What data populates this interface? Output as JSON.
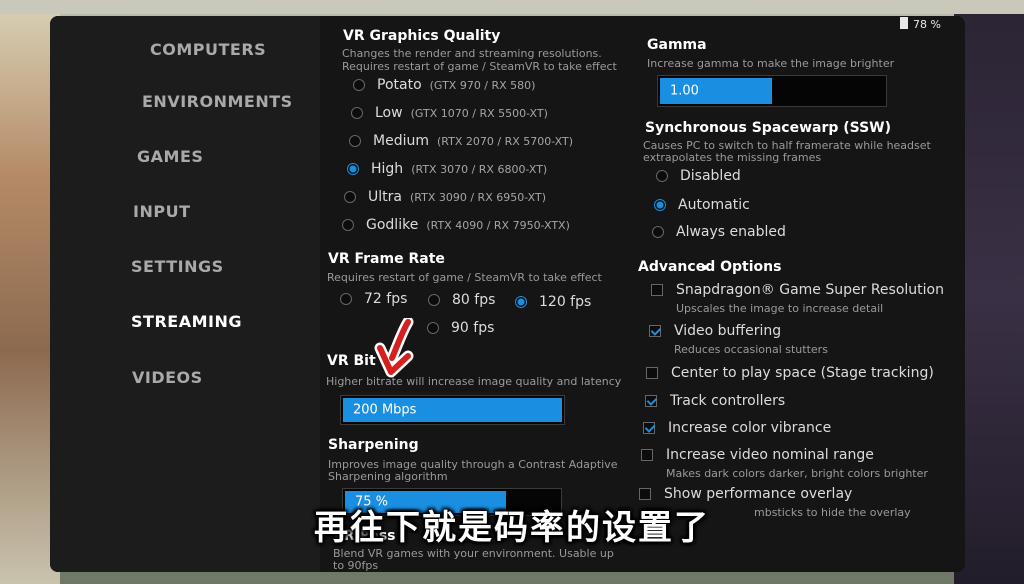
{
  "status": {
    "battery": "78 %"
  },
  "sidebar": {
    "items": [
      {
        "label": "COMPUTERS"
      },
      {
        "label": "ENVIRONMENTS"
      },
      {
        "label": "GAMES"
      },
      {
        "label": "INPUT"
      },
      {
        "label": "SETTINGS"
      },
      {
        "label": "STREAMING",
        "active": true
      },
      {
        "label": "VIDEOS"
      }
    ]
  },
  "graphics_quality": {
    "title": "VR Graphics Quality",
    "desc1": "Changes the render and streaming resolutions.",
    "desc2": "Requires restart of game / SteamVR to take effect",
    "options": [
      {
        "label": "Potato",
        "spec": "(GTX 970 / RX 580)",
        "selected": false
      },
      {
        "label": "Low",
        "spec": "(GTX 1070 / RX 5500-XT)",
        "selected": false
      },
      {
        "label": "Medium",
        "spec": "(RTX 2070 / RX 5700-XT)",
        "selected": false
      },
      {
        "label": "High",
        "spec": "(RTX 3070 / RX 6800-XT)",
        "selected": true
      },
      {
        "label": "Ultra",
        "spec": "(RTX 3090 / RX 6950-XT)",
        "selected": false
      },
      {
        "label": "Godlike",
        "spec": "(RTX 4090 / RX 7950-XTX)",
        "selected": false
      }
    ]
  },
  "frame_rate": {
    "title": "VR Frame Rate",
    "desc": "Requires restart of game / SteamVR to take effect",
    "options": [
      {
        "label": "72 fps",
        "selected": false
      },
      {
        "label": "80 fps",
        "selected": false
      },
      {
        "label": "120 fps",
        "selected": true
      },
      {
        "label": "90 fps",
        "selected": false
      }
    ]
  },
  "bitrate": {
    "title": "VR Bit",
    "desc": "Higher bitrate will increase image quality and latency",
    "value": "200 Mbps",
    "fill_fraction": 1.0
  },
  "sharpening": {
    "title": "Sharpening",
    "desc1": "Improves image quality through a Contrast Adaptive",
    "desc2": "Sharpening algorithm",
    "value": "75 %",
    "fill_fraction": 0.75
  },
  "passthrough": {
    "title": "VR Pass",
    "desc1": "Blend VR games with your environment. Usable up",
    "desc2": "to 90fps"
  },
  "gamma": {
    "title": "Gamma",
    "desc": "Increase gamma to make the image brighter",
    "value": "1.00",
    "fill_fraction": 0.5
  },
  "ssw": {
    "title": "Synchronous Spacewarp (SSW)",
    "desc1": "Causes PC to switch to half framerate while headset",
    "desc2": "extrapolates the missing frames",
    "options": [
      {
        "label": "Disabled",
        "selected": false
      },
      {
        "label": "Automatic",
        "selected": true
      },
      {
        "label": "Always enabled",
        "selected": false
      }
    ]
  },
  "advanced": {
    "title": "Advanced Options",
    "options": [
      {
        "label": "Snapdragon® Game Super Resolution",
        "desc": "Upscales the image to increase detail",
        "checked": false
      },
      {
        "label": "Video buffering",
        "desc": "Reduces occasional stutters",
        "checked": true
      },
      {
        "label": "Center to play space (Stage tracking)",
        "desc": "",
        "checked": false
      },
      {
        "label": "Track controllers",
        "desc": "",
        "checked": true
      },
      {
        "label": "Increase color vibrance",
        "desc": "",
        "checked": true
      },
      {
        "label": "Increase video nominal range",
        "desc": "Makes dark colors darker, bright colors brighter",
        "checked": false
      },
      {
        "label": "Show performance overlay",
        "desc": "mbsticks to hide the overlay",
        "checked": false
      }
    ]
  },
  "caption": "再往下就是码率的设置了",
  "colors": {
    "accent": "#1a8ee0",
    "panel": "#151515",
    "sidebar": "#1c1c1c",
    "arrow": "#d42020"
  }
}
